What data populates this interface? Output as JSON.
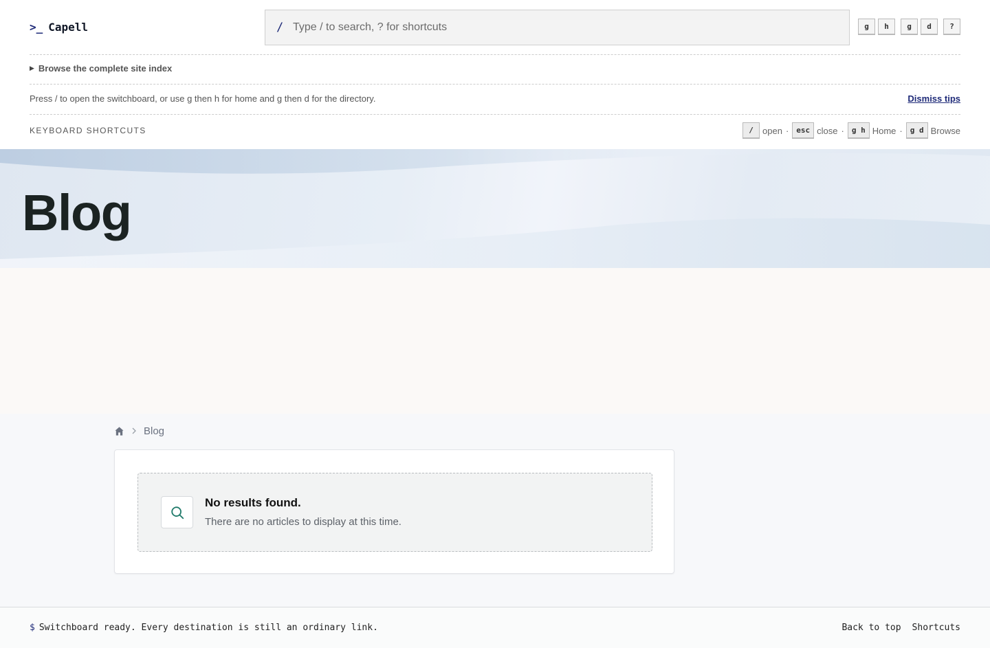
{
  "brand": {
    "prompt": ">_",
    "name": "Capell"
  },
  "search": {
    "slash": "/",
    "placeholder": "Type / to search, ? for shortcuts"
  },
  "header_keys": [
    [
      "g",
      "h"
    ],
    [
      "g",
      "d"
    ],
    [
      "?"
    ]
  ],
  "site_index": {
    "label": "Browse the complete site index"
  },
  "tips": {
    "text": "Press / to open the switchboard, or use g then h for home and g then d for the directory.",
    "dismiss": "Dismiss tips"
  },
  "shortcuts": {
    "title": "KEYBOARD SHORTCUTS",
    "items": [
      {
        "key": "/",
        "label": "open"
      },
      {
        "key": "esc",
        "label": "close"
      },
      {
        "key": "g h",
        "label": "Home"
      },
      {
        "key": "g d",
        "label": "Browse"
      }
    ],
    "separator": "·"
  },
  "hero": {
    "title": "Blog"
  },
  "breadcrumb": {
    "home_icon": "home-icon",
    "current": "Blog"
  },
  "empty_state": {
    "icon": "search-icon",
    "title": "No results found.",
    "description": "There are no articles to display at this time."
  },
  "footer": {
    "prompt": "$",
    "status": "Switchboard ready. Every destination is still an ordinary link.",
    "back_to_top": "Back to top",
    "shortcuts": "Shortcuts"
  },
  "colors": {
    "accent": "#1e2a78",
    "empty_icon": "#1f7a6a",
    "hero_title": "#1b2322"
  }
}
